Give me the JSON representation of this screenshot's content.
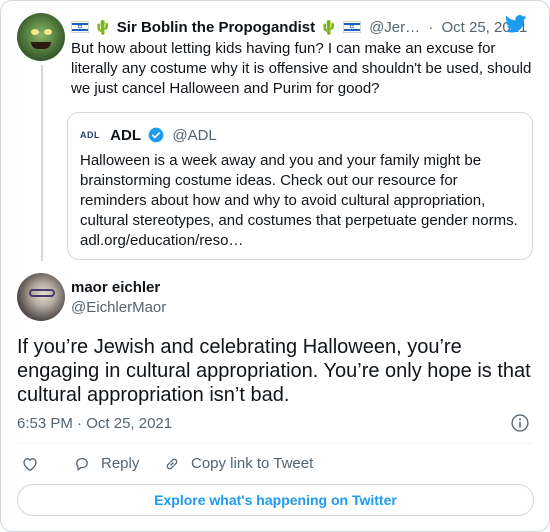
{
  "parent_tweet": {
    "author_name": "Sir Boblin the Propogandist",
    "handle": "@Jer…",
    "separator": "·",
    "timestamp": "Oct 25, 2021",
    "text": "But how about letting kids having fun? I can make an excuse for literally any costume why it is offensive and shouldn't be used, should we just cancel Halloween and Purim for good?",
    "name_decorations": [
      "israel-flag",
      "cactus"
    ]
  },
  "quoted_tweet": {
    "logo_text": "ADL",
    "author_name": "ADL",
    "handle": "@ADL",
    "text": "Halloween is a week away and you and your family might be brainstorming costume ideas. Check out our resource for reminders about how and why to avoid cultural appropriation, cultural stereotypes, and costumes that perpetuate gender norms. adl.org/education/reso…"
  },
  "main_tweet": {
    "author_name": "maor eichler",
    "handle": "@EichlerMaor",
    "text": "If you’re Jewish and celebrating Halloween, you’re engaging in cultural appropriation. You’re only hope is that cultural appropriation isn’t bad.",
    "time": "6:53 PM",
    "separator": "·",
    "date": "Oct 25, 2021"
  },
  "actions": {
    "reply_label": "Reply",
    "copy_link_label": "Copy link to Tweet"
  },
  "explore_button_label": "Explore what's happening on Twitter",
  "colors": {
    "accent": "#1d9bf0",
    "text_primary": "#0f1419",
    "text_secondary": "#536471",
    "border": "#cfd9de",
    "verified": "#1d9bf0"
  },
  "icons": [
    "twitter-bird-icon",
    "verified-badge-icon",
    "info-icon",
    "heart-icon",
    "reply-icon",
    "link-icon"
  ]
}
